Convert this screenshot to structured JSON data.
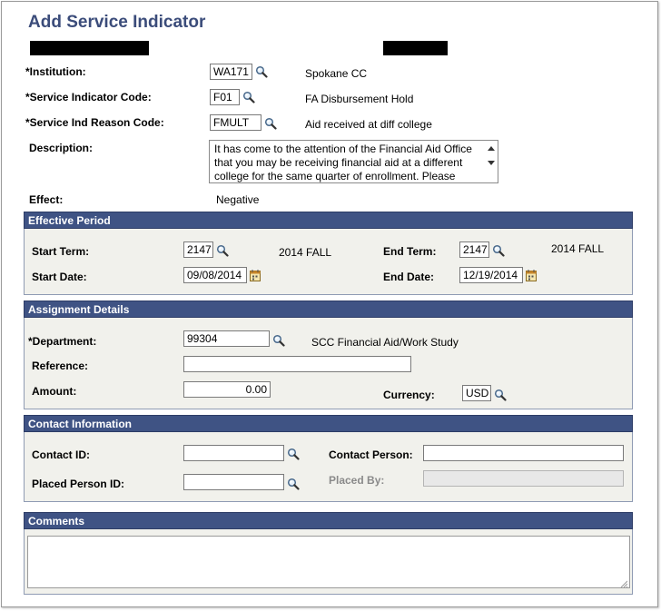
{
  "page": {
    "title": "Add Service Indicator"
  },
  "header_fields": {
    "institution": {
      "label": "*Institution:",
      "value": "WA171",
      "description": "Spokane CC"
    },
    "service_indicator_code": {
      "label": "*Service Indicator Code:",
      "value": "F01",
      "description": "FA Disbursement Hold"
    },
    "service_ind_reason_code": {
      "label": "*Service Ind Reason Code:",
      "value": "FMULT",
      "description": "Aid received at diff college"
    },
    "description": {
      "label": "Description:",
      "text": "It has come to the attention of the Financial Aid Office that you may be receiving financial aid at a different college for the same quarter of enrollment.  Please"
    },
    "effect": {
      "label": "Effect:",
      "value": "Negative"
    }
  },
  "effective_period": {
    "heading": "Effective Period",
    "start_term": {
      "label": "Start Term:",
      "value": "2147",
      "description": "2014 FALL"
    },
    "end_term": {
      "label": "End Term:",
      "value": "2147",
      "description": "2014 FALL"
    },
    "start_date": {
      "label": "Start Date:",
      "value": "09/08/2014"
    },
    "end_date": {
      "label": "End Date:",
      "value": "12/19/2014"
    }
  },
  "assignment_details": {
    "heading": "Assignment Details",
    "department": {
      "label": "*Department:",
      "value": "99304",
      "description": "SCC Financial Aid/Work Study"
    },
    "reference": {
      "label": "Reference:",
      "value": ""
    },
    "amount": {
      "label": "Amount:",
      "value": "0.00"
    },
    "currency": {
      "label": "Currency:",
      "value": "USD"
    }
  },
  "contact_information": {
    "heading": "Contact Information",
    "contact_id": {
      "label": "Contact ID:",
      "value": ""
    },
    "contact_person": {
      "label": "Contact Person:",
      "value": ""
    },
    "placed_person_id": {
      "label": "Placed Person ID:",
      "value": ""
    },
    "placed_by": {
      "label": "Placed By:",
      "value": ""
    }
  },
  "comments": {
    "heading": "Comments",
    "value": ""
  },
  "icons": {
    "lookup": "magnifier-lookup-icon",
    "calendar": "calendar-icon"
  },
  "colors": {
    "title": "#3b4c7a",
    "section_header": "#3f5384",
    "section_background": "#f1f1ec"
  }
}
